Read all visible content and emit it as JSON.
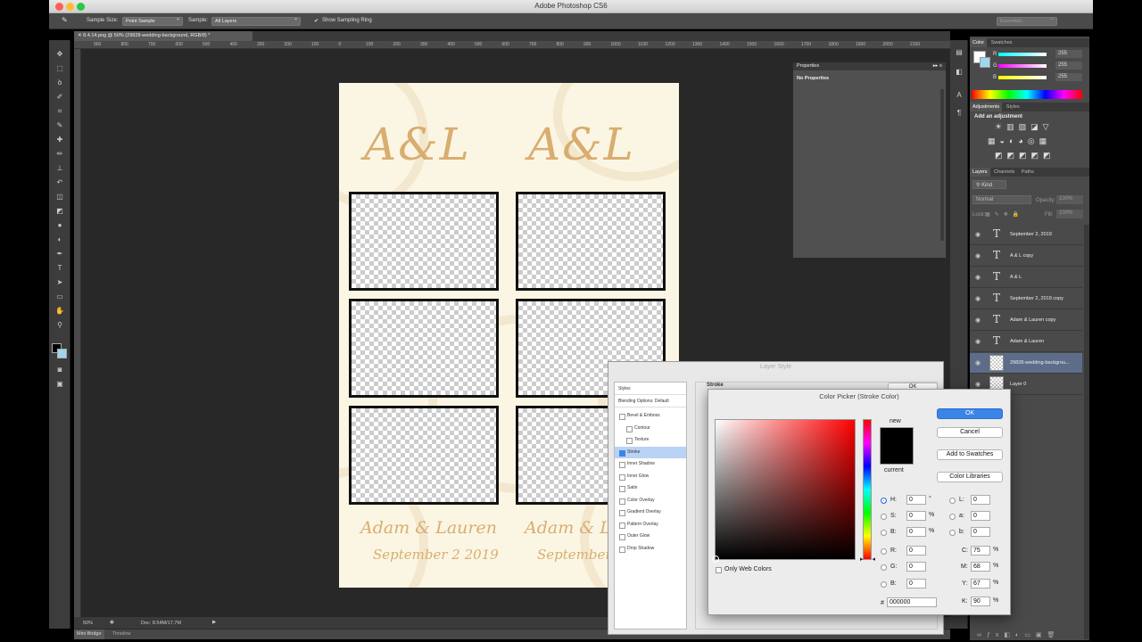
{
  "window": {
    "title": "Adobe Photoshop CS6"
  },
  "options_bar": {
    "sample_size_label": "Sample Size:",
    "sample_size_value": "Point Sample",
    "sample_label": "Sample:",
    "sample_value": "All Layers",
    "show_ring_label": "Show Sampling Ring",
    "workspace": "Essentials"
  },
  "document_tab": {
    "title": "8.4.14.png @ 50% (29828-wedding-background, RGB/8) *"
  },
  "ruler": {
    "ticks": [
      "900",
      "800",
      "700",
      "600",
      "500",
      "400",
      "300",
      "200",
      "100",
      "0",
      "100",
      "200",
      "300",
      "400",
      "500",
      "600",
      "700",
      "800",
      "900",
      "1000",
      "1100",
      "1200",
      "1300",
      "1400",
      "1500",
      "1600",
      "1700",
      "1800",
      "1900",
      "2000",
      "2100"
    ]
  },
  "artwork": {
    "monogram_left": "A&L",
    "monogram_right": "A&L",
    "names_left": "Adam & Lauren",
    "names_right": "Adam & Lauren",
    "date_left": "September 2 2019",
    "date_right": "September 2 2019"
  },
  "status_bar": {
    "zoom": "50%",
    "doc_info": "Doc: 8.54M/17.7M"
  },
  "bottom_tabs": [
    "Mini Bridge",
    "Timeline"
  ],
  "properties_panel": {
    "title": "Properties",
    "content": "No Properties"
  },
  "color_panel": {
    "tabs": [
      "Color",
      "Swatches"
    ],
    "r_label": "R",
    "g_label": "G",
    "b_label": "B",
    "r": "255",
    "g": "255",
    "b": "255"
  },
  "adjustments_panel": {
    "tabs": [
      "Adjustments",
      "Styles"
    ],
    "heading": "Add an adjustment"
  },
  "layers_panel": {
    "tabs": [
      "Layers",
      "Channels",
      "Paths"
    ],
    "kind_label": "Kind",
    "blend_mode": "Normal",
    "opacity_label": "Opacity:",
    "opacity_value": "100%",
    "lock_label": "Lock:",
    "fill_label": "Fill:",
    "fill_value": "100%",
    "layers": [
      {
        "name": "September 2, 2019",
        "type": "text"
      },
      {
        "name": "A & L copy",
        "type": "text"
      },
      {
        "name": "A & L",
        "type": "text"
      },
      {
        "name": "September 2, 2019 copy",
        "type": "text"
      },
      {
        "name": "Adam & Lauren copy",
        "type": "text"
      },
      {
        "name": "Adam & Lauren",
        "type": "text"
      },
      {
        "name": "29828-wedding-backgrou...",
        "type": "image",
        "selected": true
      },
      {
        "name": "Layer 0",
        "type": "image"
      }
    ]
  },
  "layer_style_dialog": {
    "title": "Layer Style",
    "styles_header": "Styles",
    "blending_options": "Blending Options: Default",
    "items": [
      "Bevel & Emboss",
      "Contour",
      "Texture",
      "Stroke",
      "Inner Shadow",
      "Inner Glow",
      "Satin",
      "Color Overlay",
      "Gradient Overlay",
      "Pattern Overlay",
      "Outer Glow",
      "Drop Shadow"
    ],
    "selected_item": "Stroke",
    "section_title": "Stroke",
    "ok_label": "OK"
  },
  "color_picker": {
    "title": "Color Picker (Stroke Color)",
    "new_label": "new",
    "current_label": "current",
    "ok_label": "OK",
    "cancel_label": "Cancel",
    "add_swatches_label": "Add to Swatches",
    "color_libraries_label": "Color Libraries",
    "only_web_colors_label": "Only Web Colors",
    "h_label": "H:",
    "h_value": "0",
    "h_unit": "°",
    "s_label": "S:",
    "s_value": "0",
    "s_unit": "%",
    "b_label": "B:",
    "b_value": "0",
    "b_unit": "%",
    "r_label": "R:",
    "r_value": "0",
    "g_label": "G:",
    "g_value": "0",
    "bb_label": "B:",
    "bb_value": "0",
    "l_label": "L:",
    "l_value": "0",
    "a_label": "a:",
    "a_value": "0",
    "b2_label": "b:",
    "b2_value": "0",
    "c_label": "C:",
    "c_value": "75",
    "c_unit": "%",
    "m_label": "M:",
    "m_value": "68",
    "m_unit": "%",
    "y_label": "Y:",
    "y_value": "67",
    "y_unit": "%",
    "k_label": "K:",
    "k_value": "90",
    "k_unit": "%",
    "hex_label": "#",
    "hex_value": "000000",
    "new_color": "#000000",
    "current_color": "#000000"
  },
  "colors": {
    "accent": "#3b84e8",
    "gold": "#d9ad70",
    "paper": "#fbf6e3"
  }
}
